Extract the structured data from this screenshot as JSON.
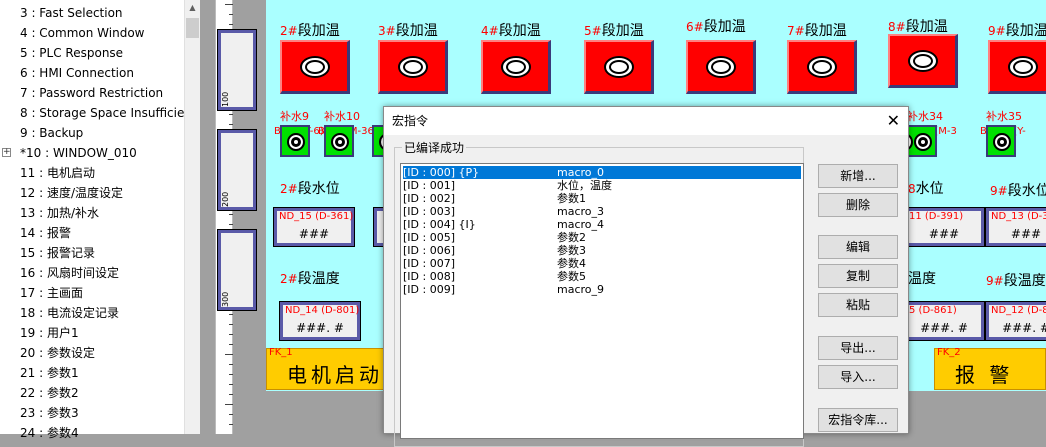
{
  "tree": {
    "items": [
      "3 : Fast Selection",
      "4 : Common Window",
      "5 : PLC Response",
      "6 : HMI Connection",
      "7 : Password Restriction",
      "8 : Storage Space Insufficien",
      "9 : Backup",
      "*10 : WINDOW_010",
      "11 : 电机启动",
      "12 : 速度/温度设定",
      "13 : 加热/补水",
      "14 : 报警",
      "15 : 报警记录",
      "16 : 风扇时间设定",
      "17 : 主画面",
      "18 : 电流设定记录",
      "19 : 用户1",
      "20 : 参数设定",
      "21 : 参数1",
      "22 : 参数2",
      "23 : 参数3",
      "24 : 参数4"
    ],
    "expander": "+"
  },
  "ruler": {
    "labels": [
      "100",
      "200",
      "300"
    ]
  },
  "canvas": {
    "heat_labels": [
      {
        "pre": "2#",
        "text": "段加温"
      },
      {
        "pre": "3#",
        "text": "段加温"
      },
      {
        "pre": "4#",
        "text": "段加温"
      },
      {
        "pre": "5#",
        "text": "段加温"
      },
      {
        "pre": "6#",
        "text": "段加温"
      },
      {
        "pre": "7#",
        "text": "段加温"
      },
      {
        "pre": "8#",
        "text": "段加温"
      },
      {
        "pre": "9#",
        "text": "段加温"
      }
    ],
    "lamp_labels": [
      "补水9",
      "补水10",
      "补水34",
      "补水35"
    ],
    "lamp_ids": [
      "BL_3 (Y-6)",
      "BL_4 (M-36",
      "BL_18 (M-3",
      "BL_24 (Y-"
    ],
    "water_left": {
      "pre": "2#",
      "text": "段水位"
    },
    "water_right_a": {
      "pre": "8",
      "text": "水位"
    },
    "water_right_b": {
      "pre": "9#",
      "text": "段水位"
    },
    "temp_left": {
      "pre": "2#",
      "text": "段温度"
    },
    "temp_right_a": {
      "pre": "",
      "text": "温度"
    },
    "temp_right_b": {
      "pre": "9#",
      "text": "段温度"
    },
    "num_water": [
      {
        "tag": "ND_15 (D-361)",
        "val": "###"
      },
      {
        "tag": "11 (D-391)",
        "val": "###"
      },
      {
        "tag": "ND_13 (D-3",
        "val": "###"
      }
    ],
    "num_temp": [
      {
        "tag": "ND_14 (D-801)",
        "val": "###. #"
      },
      {
        "tag": "5 (D-861)",
        "val": "###. #"
      },
      {
        "tag": "ND_12 (D-8",
        "val": "###. #"
      }
    ],
    "yellow_left": {
      "tag": "FK_1",
      "text": "电机启动"
    },
    "yellow_right": {
      "tag": "FK_2",
      "text": "报 警"
    }
  },
  "dialog": {
    "title": "宏指令",
    "close": "✕",
    "status": "已编译成功",
    "rows": [
      {
        "id": "[ID : 000] {P}",
        "name": "macro_0"
      },
      {
        "id": "[ID : 001]",
        "name": "水位，温度"
      },
      {
        "id": "[ID : 002]",
        "name": "参数1"
      },
      {
        "id": "[ID : 003]",
        "name": "macro_3"
      },
      {
        "id": "[ID : 004] {I}",
        "name": "macro_4"
      },
      {
        "id": "[ID : 005]",
        "name": "参数2"
      },
      {
        "id": "[ID : 006]",
        "name": "参数3"
      },
      {
        "id": "[ID : 007]",
        "name": "参数4"
      },
      {
        "id": "[ID : 008]",
        "name": "参数5"
      },
      {
        "id": "[ID : 009]",
        "name": "macro_9"
      }
    ],
    "buttons": {
      "add": "新增...",
      "delete": "删除",
      "edit": "编辑",
      "copy": "复制",
      "paste": "粘贴",
      "export": "导出...",
      "import": "导入...",
      "library": "宏指令库..."
    }
  }
}
